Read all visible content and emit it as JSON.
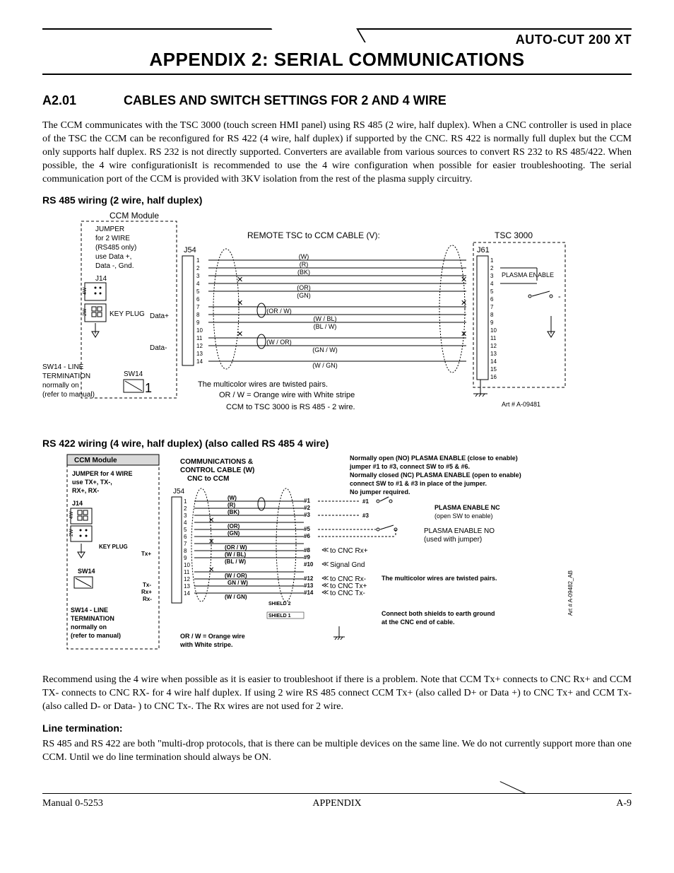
{
  "header": {
    "model": "AUTO-CUT 200 XT",
    "appendix_title": "APPENDIX 2:  SERIAL COMMUNICATIONS"
  },
  "section": {
    "number": "A2.01",
    "title": "CABLES AND SWITCH SETTINGS FOR 2 AND 4 WIRE"
  },
  "intro_para": "The CCM communicates with the TSC 3000 (touch screen HMI panel) using RS 485 (2 wire, half duplex).  When a CNC controller is used in place of the TSC the CCM can be reconfigured for RS 422 (4 wire, half duplex) if supported by the CNC.   RS 422 is normally full duplex but the CCM only supports half duplex.  RS 232 is not directly supported.  Converters are available from various sources to convert RS 232 to RS 485/422. When possible, the 4 wire configurationisIt is recommended to use the 4 wire configuration when possible for easier troubleshooting. The serial communication port of the CCM is provided with 3KV isolation from the rest of the plasma supply circuitry.",
  "diagram1": {
    "heading": "RS 485 wiring (2 wire, half duplex)",
    "ccm_module": "CCM Module",
    "jumper_lines": [
      "JUMPER",
      "for  2 WIRE",
      "(RS485 only)",
      "use Data +,",
      "Data -, Gnd."
    ],
    "j14": "J14",
    "key_plug": "KEY PLUG",
    "data_plus": "Data+",
    "data_minus": "Data-",
    "sw14": "SW14",
    "sw14_num": "1",
    "sw14_lines": [
      "SW14 - LINE",
      "TERMINATION",
      "normally on",
      "(refer to manual)"
    ],
    "remote_label": "REMOTE TSC to CCM CABLE (V):",
    "j54": "J54",
    "j61": "J61",
    "tsc3000": "TSC 3000",
    "plasma_enable": "PLASMA ENABLE",
    "dash": "-",
    "wires": [
      "(W)",
      "(R)",
      "(BK)",
      "(OR)",
      "(GN)",
      "(OR / W)",
      "(W / BL)",
      "(BL / W)",
      "(W / OR)",
      "(GN / W)",
      "(W / GN)"
    ],
    "note1": "The multicolor wires are twisted pairs.",
    "note2": "OR / W = Orange wire with White stripe",
    "note3": "CCM to TSC 3000 is RS 485  - 2 wire.",
    "art": "Art # A-09481",
    "pins_left": [
      "1",
      "2",
      "3",
      "4",
      "5",
      "6",
      "7",
      "8",
      "9",
      "10",
      "11",
      "12",
      "13",
      "14"
    ],
    "pins_right": [
      "1",
      "2",
      "3",
      "4",
      "5",
      "6",
      "7",
      "8",
      "9",
      "10",
      "11",
      "12",
      "13",
      "14",
      "15",
      "16"
    ]
  },
  "diagram2": {
    "heading": "RS 422 wiring (4 wire, half duplex) (also called RS 485 4 wire)",
    "ccm_module": "CCM Module",
    "jumper_lines": [
      "JUMPER  for 4 WIRE",
      "use TX+, TX-,",
      "RX+, RX-"
    ],
    "j14": "J14",
    "key_plug": "KEY PLUG",
    "tx_plus": "Tx+",
    "tx_minus_rx": [
      "Tx-",
      "Rx+",
      "Rx-"
    ],
    "sw14": "SW14",
    "sw14_lines": [
      "SW14 - LINE",
      "TERMINATION",
      "normally on",
      "(refer to  manual)"
    ],
    "comm_title": [
      "COMMUNICATIONS &",
      "CONTROL CABLE (W)",
      "CNC to CCM"
    ],
    "j54": "J54",
    "wires": [
      "(W)",
      "(R)",
      "(BK)",
      "(OR)",
      "(GN)",
      "(OR / W)",
      "(W / BL)",
      "(BL / W)",
      "(W / OR)",
      "GN / W)",
      "(W / GN)"
    ],
    "pin_labels": [
      "#1",
      "#2",
      "#3",
      "#5",
      "#6",
      "#8",
      "#9",
      "#10",
      "#12",
      "#13",
      "#14"
    ],
    "right_pins": [
      "#1",
      "#3"
    ],
    "cnc_labels": [
      "to CNC Rx+",
      "Signal Gnd",
      "to CNC Rx-",
      "to CNC Tx+",
      "to CNC Tx-"
    ],
    "shield1": "SHIELD 1",
    "shield2": "SHIELD 2",
    "or_note": [
      "OR / W   = Orange wire",
      "with White stripe."
    ],
    "no_lines": [
      "Normally open (NO) PLASMA ENABLE (close to enable)",
      "jumper #1 to #3, connect SW to #5 & #6.",
      "Normally closed (NC) PLASMA ENABLE (open to enable)",
      "connect SW to #1 & #3 in place of the jumper.",
      "No jumper required."
    ],
    "plasma_nc": [
      "PLASMA ENABLE NC",
      "(open SW to enable)"
    ],
    "plasma_no": [
      "PLASMA ENABLE NO",
      "(used with jumper)"
    ],
    "twisted_note": "The multicolor wires are twisted pairs.",
    "shield_note": [
      "Connect both shields to earth ground",
      "at the CNC end of cable."
    ],
    "art": "Art # A-09482_AB",
    "pins_left": [
      "1",
      "2",
      "3",
      "4",
      "5",
      "6",
      "7",
      "8",
      "9",
      "10",
      "11",
      "12",
      "13",
      "14"
    ]
  },
  "para2": "Recommend using the 4 wire when possible as it is easier to troubleshoot if there is a problem. Note that CCM Tx+ connects to  CNC Rx+ and CCM TX- connects to CNC RX- for 4 wire half duplex.  If using 2 wire RS 485 connect CCM Tx+ (also called D+ or Data +) to CNC Tx+ and CCM Tx- (also called D- or Data- ) to CNC Tx-.  The Rx wires are not used for 2 wire.",
  "line_term_heading": "Line termination:",
  "line_term_para": "RS 485 and RS 422 are both \"multi-drop protocols, that is there can be multiple devices on the same line.   We do not currently support more than one CCM. Until we do line termination should always be ON.",
  "footer": {
    "left": "Manual 0-5253",
    "center": "APPENDIX",
    "right": "A-9"
  }
}
